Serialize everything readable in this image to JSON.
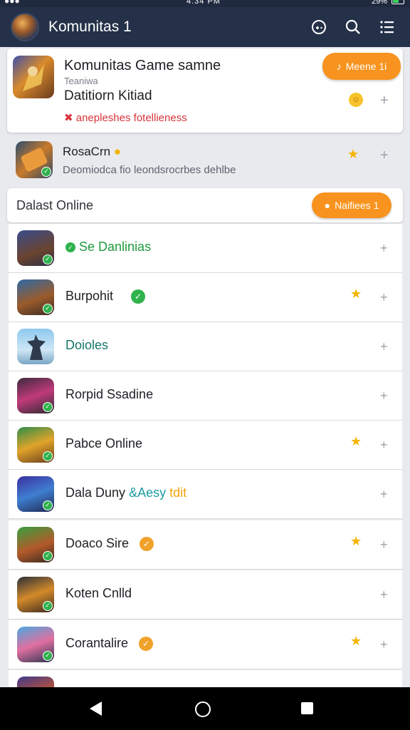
{
  "status_bar": {
    "time": "4:34 PM",
    "battery": "29%"
  },
  "app_bar": {
    "title": "Komunitas 1",
    "icons": [
      "avatar",
      "game-controller-icon",
      "search-icon",
      "menu-icon"
    ]
  },
  "featured": {
    "title": "Komunitas Game samne",
    "subtitle": "Teaniwa",
    "line2": "Datitiorn Kitiad",
    "warning": "anepleshes fotellieness",
    "pill_label": "Meene 1i",
    "accent": "#f7931e"
  },
  "second_item": {
    "title": "RosaCrn",
    "description": "Deomiodca fio leondsrocrbes dehlbe"
  },
  "section": {
    "label": "Dalast Online",
    "pill_label": "Naifiees 1"
  },
  "list_items": [
    {
      "name": "Se Danlinias",
      "color": "green",
      "badge": "",
      "star": false
    },
    {
      "name": "Burpohit",
      "color": "",
      "badge": "check",
      "star": true
    },
    {
      "name": "Doioles",
      "color": "teal",
      "badge": "",
      "star": false
    },
    {
      "name": "Rorpid Ssadine",
      "color": "",
      "badge": "",
      "star": false
    },
    {
      "name": "Pabce Online",
      "color": "",
      "badge": "",
      "star": true
    },
    {
      "name": "Dala Duny",
      "suffix": "&Aesy",
      "suffix2": "tdit",
      "color": "",
      "badge": "",
      "star": false
    },
    {
      "name": "Doaco Sire",
      "color": "",
      "badge": "orange",
      "star": true
    },
    {
      "name": "Koten Cnlld",
      "color": "",
      "badge": "",
      "star": false
    },
    {
      "name": "Corantalire",
      "color": "",
      "badge": "orange",
      "star": true
    }
  ]
}
